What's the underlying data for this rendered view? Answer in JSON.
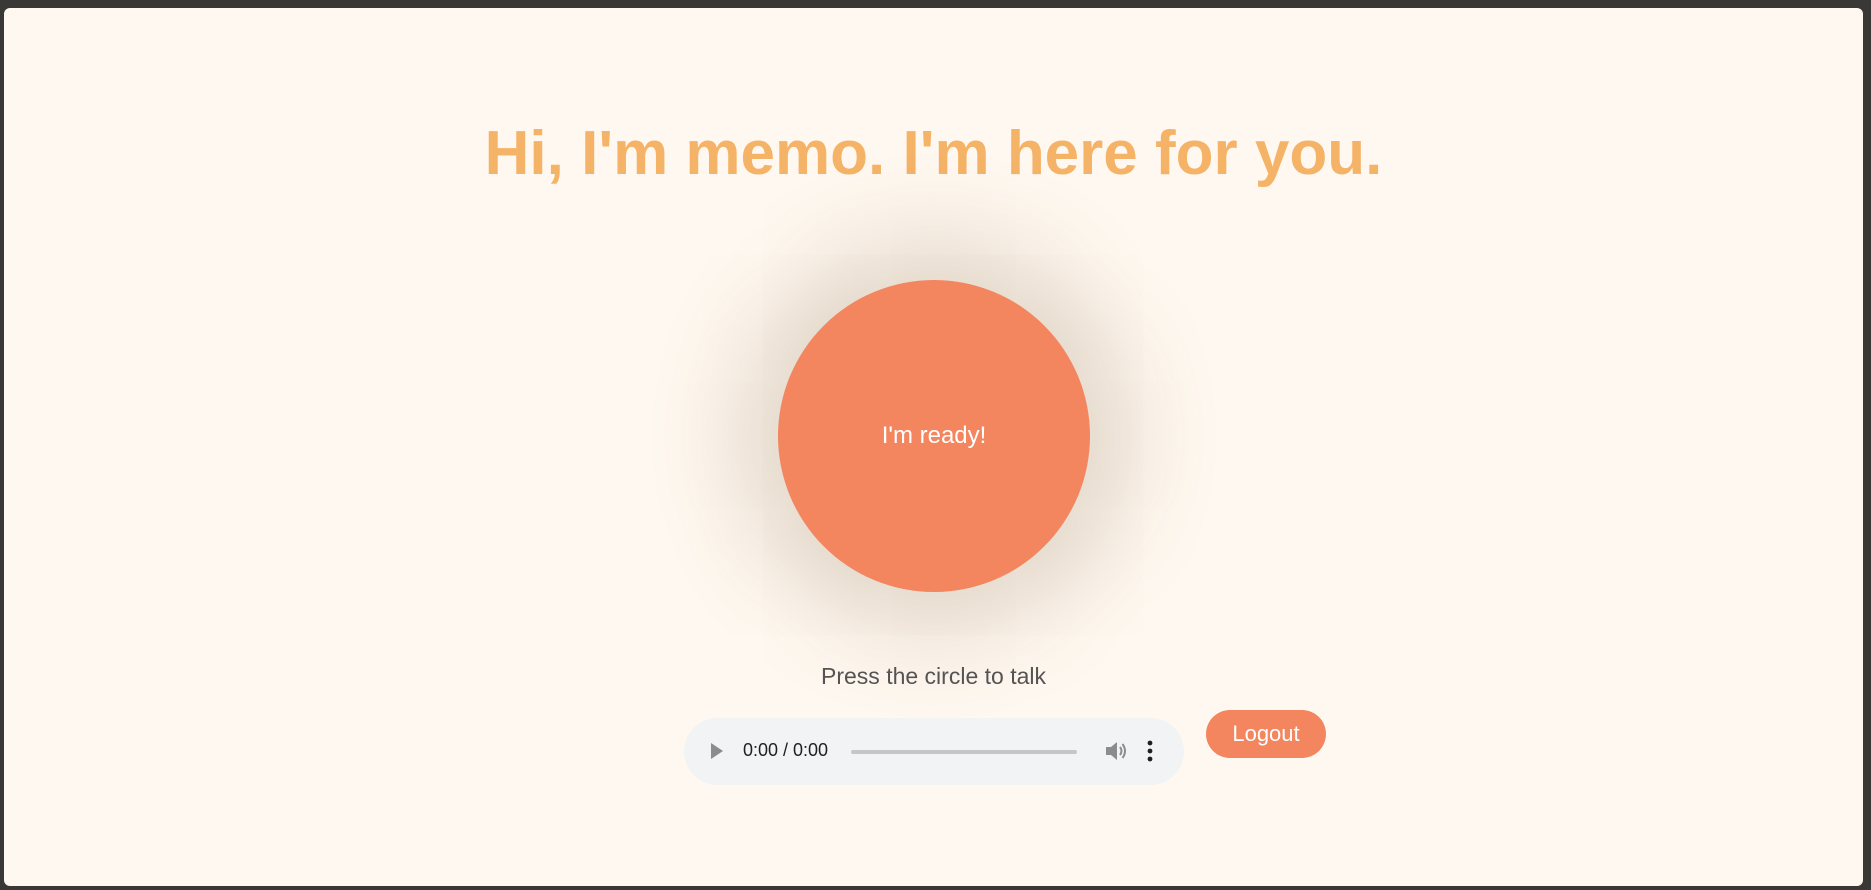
{
  "header": {
    "title": "Hi, I'm memo. I'm here for you."
  },
  "talk_circle": {
    "label": "I'm ready!"
  },
  "hint": {
    "text": "Press the circle to talk"
  },
  "audio_player": {
    "time": "0:00 / 0:00",
    "icons": {
      "play": "play-icon",
      "volume": "volume-icon",
      "more": "more-vertical-icon"
    }
  },
  "logout": {
    "label": "Logout"
  },
  "colors": {
    "background": "#fff8f0",
    "title": "#f5b367",
    "accent": "#f3855f",
    "hint_text": "#555353",
    "player_bg": "#f1f3f4"
  }
}
